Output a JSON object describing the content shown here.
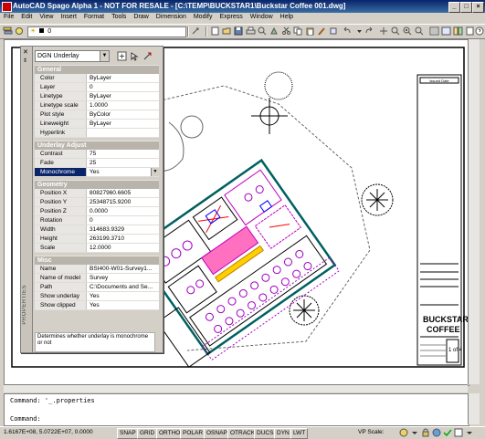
{
  "window": {
    "title": "AutoCAD Spago Alpha 1 - NOT FOR RESALE - [C:\\TEMP\\BUCKSTAR1\\Buckstar Coffee 001.dwg]",
    "controls": [
      "_",
      "□",
      "×"
    ]
  },
  "menubar": [
    "File",
    "Edit",
    "View",
    "Insert",
    "Format",
    "Tools",
    "Draw",
    "Dimension",
    "Modify",
    "Express",
    "Window",
    "Help"
  ],
  "toolbar": {
    "layer_value": "0"
  },
  "properties": {
    "object_type": "DGN Underlay",
    "palette_label": "PROPERTIES",
    "sections": [
      {
        "title": "General",
        "rows": [
          {
            "key": "Color",
            "value": "ByLayer"
          },
          {
            "key": "Layer",
            "value": "0"
          },
          {
            "key": "Linetype",
            "value": "ByLayer"
          },
          {
            "key": "Linetype scale",
            "value": "1.0000"
          },
          {
            "key": "Plot style",
            "value": "ByColor"
          },
          {
            "key": "Lineweight",
            "value": "ByLayer"
          },
          {
            "key": "Hyperlink",
            "value": ""
          }
        ]
      },
      {
        "title": "Underlay Adjust",
        "rows": [
          {
            "key": "Contrast",
            "value": "75"
          },
          {
            "key": "Fade",
            "value": "25"
          },
          {
            "key": "Monochrome",
            "value": "Yes"
          }
        ]
      },
      {
        "title": "Geometry",
        "rows": [
          {
            "key": "Position X",
            "value": "80827960.6605"
          },
          {
            "key": "Position Y",
            "value": "25348715.9200"
          },
          {
            "key": "Position Z",
            "value": "0.0000"
          },
          {
            "key": "Rotation",
            "value": "0"
          },
          {
            "key": "Width",
            "value": "314683.9329"
          },
          {
            "key": "Height",
            "value": "263199.3710"
          },
          {
            "key": "Scale",
            "value": "12.0000"
          }
        ]
      },
      {
        "title": "Misc",
        "rows": [
          {
            "key": "Name",
            "value": "BSI400-W01-Survey1..."
          },
          {
            "key": "Name of model",
            "value": "Survey"
          },
          {
            "key": "Path",
            "value": "C:\\Documents and Se..."
          },
          {
            "key": "Show underlay",
            "value": "Yes"
          },
          {
            "key": "Show clipped",
            "value": "Yes"
          }
        ]
      }
    ],
    "description": "Determines whether underlay is monochrome or not"
  },
  "title_block": {
    "header": "Issued Date",
    "company_line1": "BUCKSTAR",
    "company_line2": "COFFEE",
    "sheet": "1 of 4"
  },
  "command": {
    "history": "Command: '_.properties",
    "prompt": "Command:"
  },
  "statusbar": {
    "coords": "1.6167E+08, 5.0722E+07, 0.0000",
    "toggles": [
      "SNAP",
      "GRID",
      "ORTHO",
      "POLAR",
      "OSNAP",
      "OTRACK",
      "DUCS",
      "DYN",
      "LWT"
    ],
    "vp_scale_label": "VP Scale:"
  },
  "colors": {
    "title_bar": "#0a246a",
    "section_header": "#b8b4ac",
    "highlight": "#0a246a"
  }
}
